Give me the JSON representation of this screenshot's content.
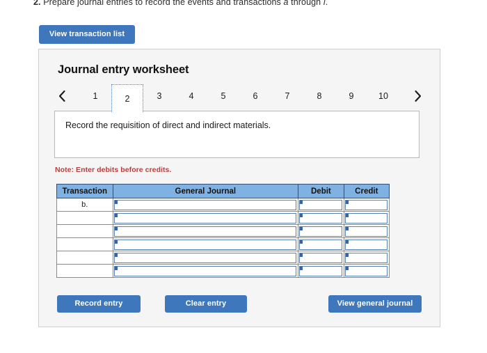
{
  "prompt": {
    "number": "2.",
    "text_before": "Prepare journal entries to record the events and transactions",
    "italic_a": "a",
    "text_middle": "through",
    "italic_i": "i",
    "text_after": "."
  },
  "toolbar": {
    "view_transaction_list_label": "View transaction list"
  },
  "worksheet": {
    "title": "Journal entry worksheet",
    "prev_icon": "chevron-left-icon",
    "next_icon": "chevron-right-icon",
    "pages": [
      "1",
      "2",
      "3",
      "4",
      "5",
      "6",
      "7",
      "8",
      "9",
      "10"
    ],
    "active_page": "2",
    "description": "Record the requisition of direct and indirect materials.",
    "note": "Note: Enter debits before credits."
  },
  "table": {
    "headers": [
      "Transaction",
      "General Journal",
      "Debit",
      "Credit"
    ],
    "rows": [
      {
        "transaction": "b.",
        "general_journal": "",
        "debit": "",
        "credit": ""
      },
      {
        "transaction": "",
        "general_journal": "",
        "debit": "",
        "credit": ""
      },
      {
        "transaction": "",
        "general_journal": "",
        "debit": "",
        "credit": ""
      },
      {
        "transaction": "",
        "general_journal": "",
        "debit": "",
        "credit": ""
      },
      {
        "transaction": "",
        "general_journal": "",
        "debit": "",
        "credit": ""
      },
      {
        "transaction": "",
        "general_journal": "",
        "debit": "",
        "credit": ""
      }
    ]
  },
  "actions": {
    "record_entry_label": "Record entry",
    "clear_entry_label": "Clear entry",
    "view_general_journal_label": "View general journal"
  },
  "colors": {
    "button_blue": "#3f77bd",
    "table_header_blue": "#7fb2e2",
    "note_red": "#b4413f",
    "cell_border_blue": "#5580b4",
    "card_background": "#f5f5f5"
  }
}
